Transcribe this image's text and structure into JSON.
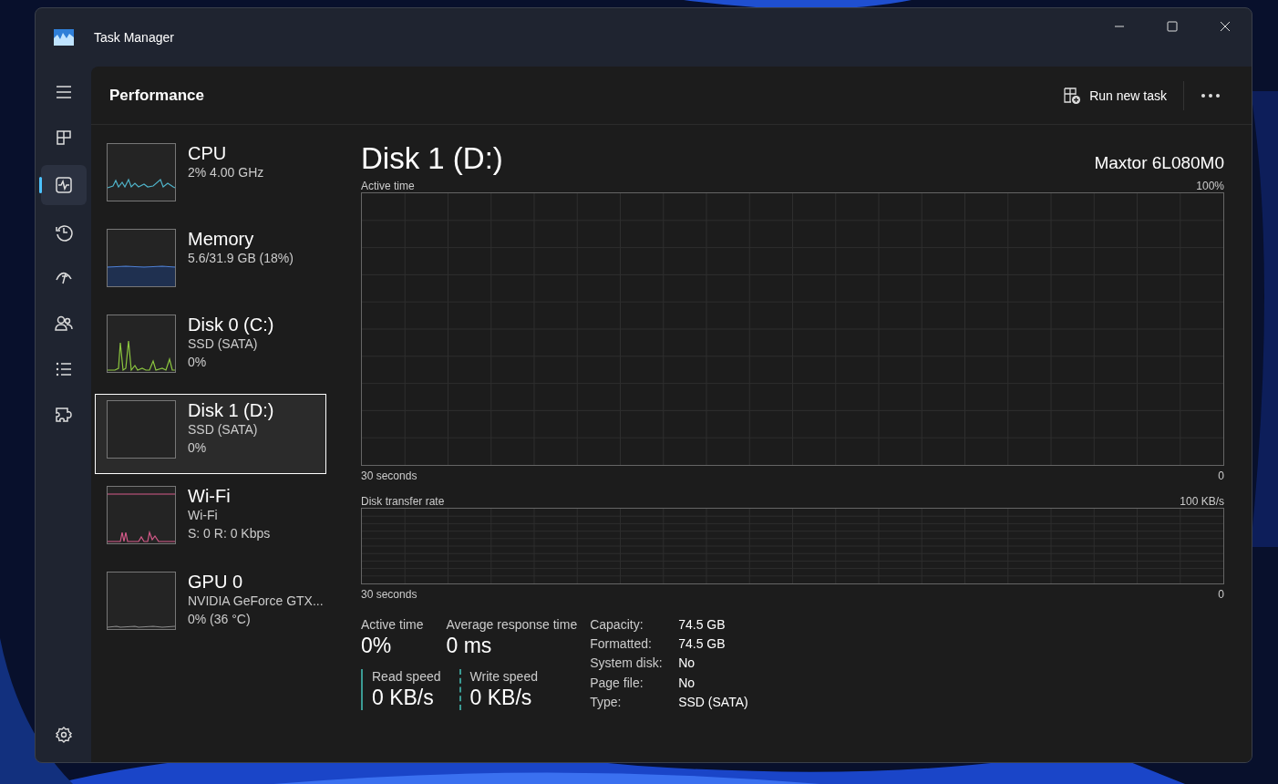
{
  "window": {
    "title": "Task Manager"
  },
  "nav": [
    {
      "selected": false
    },
    {
      "selected": false
    },
    {
      "selected": true
    },
    {
      "selected": false
    },
    {
      "selected": false
    },
    {
      "selected": false
    },
    {
      "selected": false
    },
    {
      "selected": false
    }
  ],
  "header": {
    "title": "Performance",
    "run_task": "Run new task"
  },
  "devices": [
    {
      "name": "CPU",
      "lines": [
        "2%  4.00 GHz"
      ],
      "color": "#4fb3c9",
      "selected": false
    },
    {
      "name": "Memory",
      "lines": [
        "5.6/31.9 GB (18%)"
      ],
      "color": "#4f7fd1",
      "selected": false
    },
    {
      "name": "Disk 0 (C:)",
      "lines": [
        "SSD (SATA)",
        "0%"
      ],
      "color": "#8cc63f",
      "selected": false
    },
    {
      "name": "Disk 1 (D:)",
      "lines": [
        "SSD (SATA)",
        "0%"
      ],
      "selected": true
    },
    {
      "name": "Wi-Fi",
      "lines": [
        "Wi-Fi",
        "S: 0 R: 0 Kbps"
      ],
      "color": "#d65a8a",
      "selected": false
    },
    {
      "name": "GPU 0",
      "lines": [
        "NVIDIA GeForce GTX...",
        "0%  (36 °C)"
      ],
      "color": "#8a8a8a",
      "selected": false
    }
  ],
  "detail": {
    "title": "Disk 1 (D:)",
    "model": "Maxtor 6L080M0",
    "chart1": {
      "label": "Active time",
      "max": "100%",
      "time": "30 seconds",
      "min": "0"
    },
    "chart2": {
      "label": "Disk transfer rate",
      "max": "100 KB/s",
      "time": "30 seconds",
      "min": "0"
    },
    "stats": [
      {
        "label": "Active time",
        "value": "0%"
      },
      {
        "label": "Average response time",
        "value": "0 ms"
      }
    ],
    "speeds": [
      {
        "label": "Read speed",
        "value": "0 KB/s",
        "kind": "solid"
      },
      {
        "label": "Write speed",
        "value": "0 KB/s",
        "kind": "dashed"
      }
    ],
    "props": [
      {
        "label": "Capacity:",
        "value": "74.5 GB"
      },
      {
        "label": "Formatted:",
        "value": "74.5 GB"
      },
      {
        "label": "System disk:",
        "value": "No"
      },
      {
        "label": "Page file:",
        "value": "No"
      },
      {
        "label": "Type:",
        "value": "SSD (SATA)"
      }
    ]
  }
}
